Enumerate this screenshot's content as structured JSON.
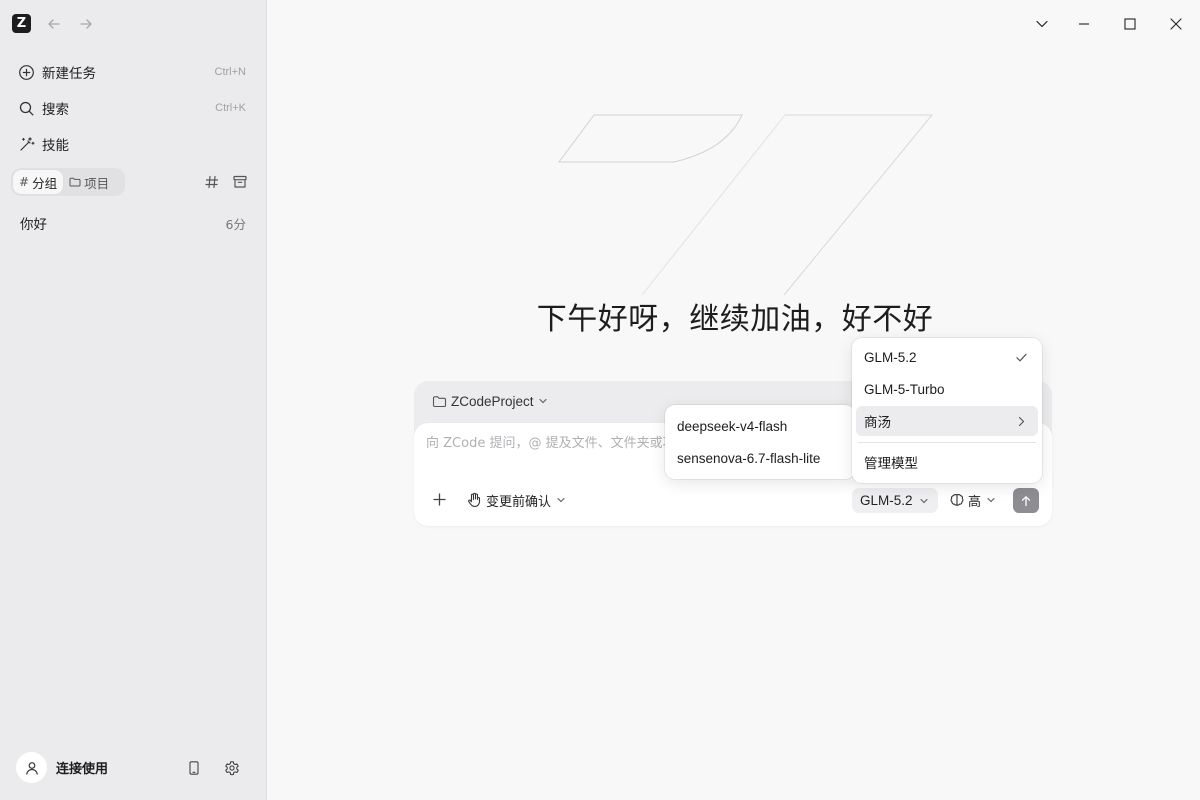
{
  "app": {
    "logo_letter": "Z"
  },
  "sidebar": {
    "items": [
      {
        "label": "新建任务",
        "shortcut": "Ctrl+N",
        "icon": "plus-circle-icon"
      },
      {
        "label": "搜索",
        "shortcut": "Ctrl+K",
        "icon": "search-icon"
      },
      {
        "label": "技能",
        "shortcut": "",
        "icon": "magic-wand-icon"
      }
    ],
    "segment": {
      "groups_label": "分组",
      "projects_label": "项目",
      "active": "groups"
    },
    "tasks": [
      {
        "title": "你好",
        "time": "6分"
      }
    ],
    "footer": {
      "user_label": "连接使用"
    }
  },
  "main": {
    "greeting": "下午好呀，继续加油，好不好",
    "composer": {
      "project_name": "ZCodeProject",
      "placeholder": "向 ZCode 提问，@ 提及文件、文件夹或项目",
      "confirm_mode": "变更前确认",
      "model": "GLM-5.2",
      "effort": "高"
    }
  },
  "model_menu": {
    "items": [
      {
        "label": "GLM-5.2",
        "selected": true
      },
      {
        "label": "GLM-5-Turbo",
        "selected": false
      },
      {
        "label": "商汤",
        "has_submenu": true
      }
    ],
    "manage_label": "管理模型"
  },
  "sub_menu": {
    "items": [
      {
        "label": "deepseek-v4-flash"
      },
      {
        "label": "sensenova-6.7-flash-lite"
      }
    ]
  },
  "colors": {
    "sidebar_bg": "#ebebed",
    "main_bg": "#f8f8f8",
    "send_button": "#8e8e92",
    "menu_hover": "#ececee"
  }
}
